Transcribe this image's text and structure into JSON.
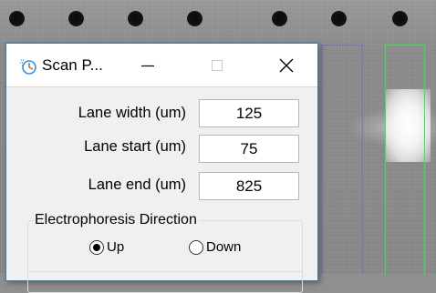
{
  "background": {
    "wells_count_label": ""
  },
  "dialog": {
    "title": "Scan P...",
    "icon": "scan-parameters-app-icon",
    "fields": [
      {
        "label": "Lane width (um)",
        "value": "125"
      },
      {
        "label": "Lane start (um)",
        "value": "75"
      },
      {
        "label": "Lane end (um)",
        "value": "825"
      }
    ],
    "direction_group": {
      "title": "Electrophoresis Direction",
      "options": [
        {
          "label": "Up",
          "selected": true
        },
        {
          "label": "Down",
          "selected": false
        }
      ]
    }
  },
  "colors": {
    "selected_lane": "#2fe84a",
    "dotted_lane": "#5a5aff",
    "dialog_border": "#3c7fb1"
  }
}
